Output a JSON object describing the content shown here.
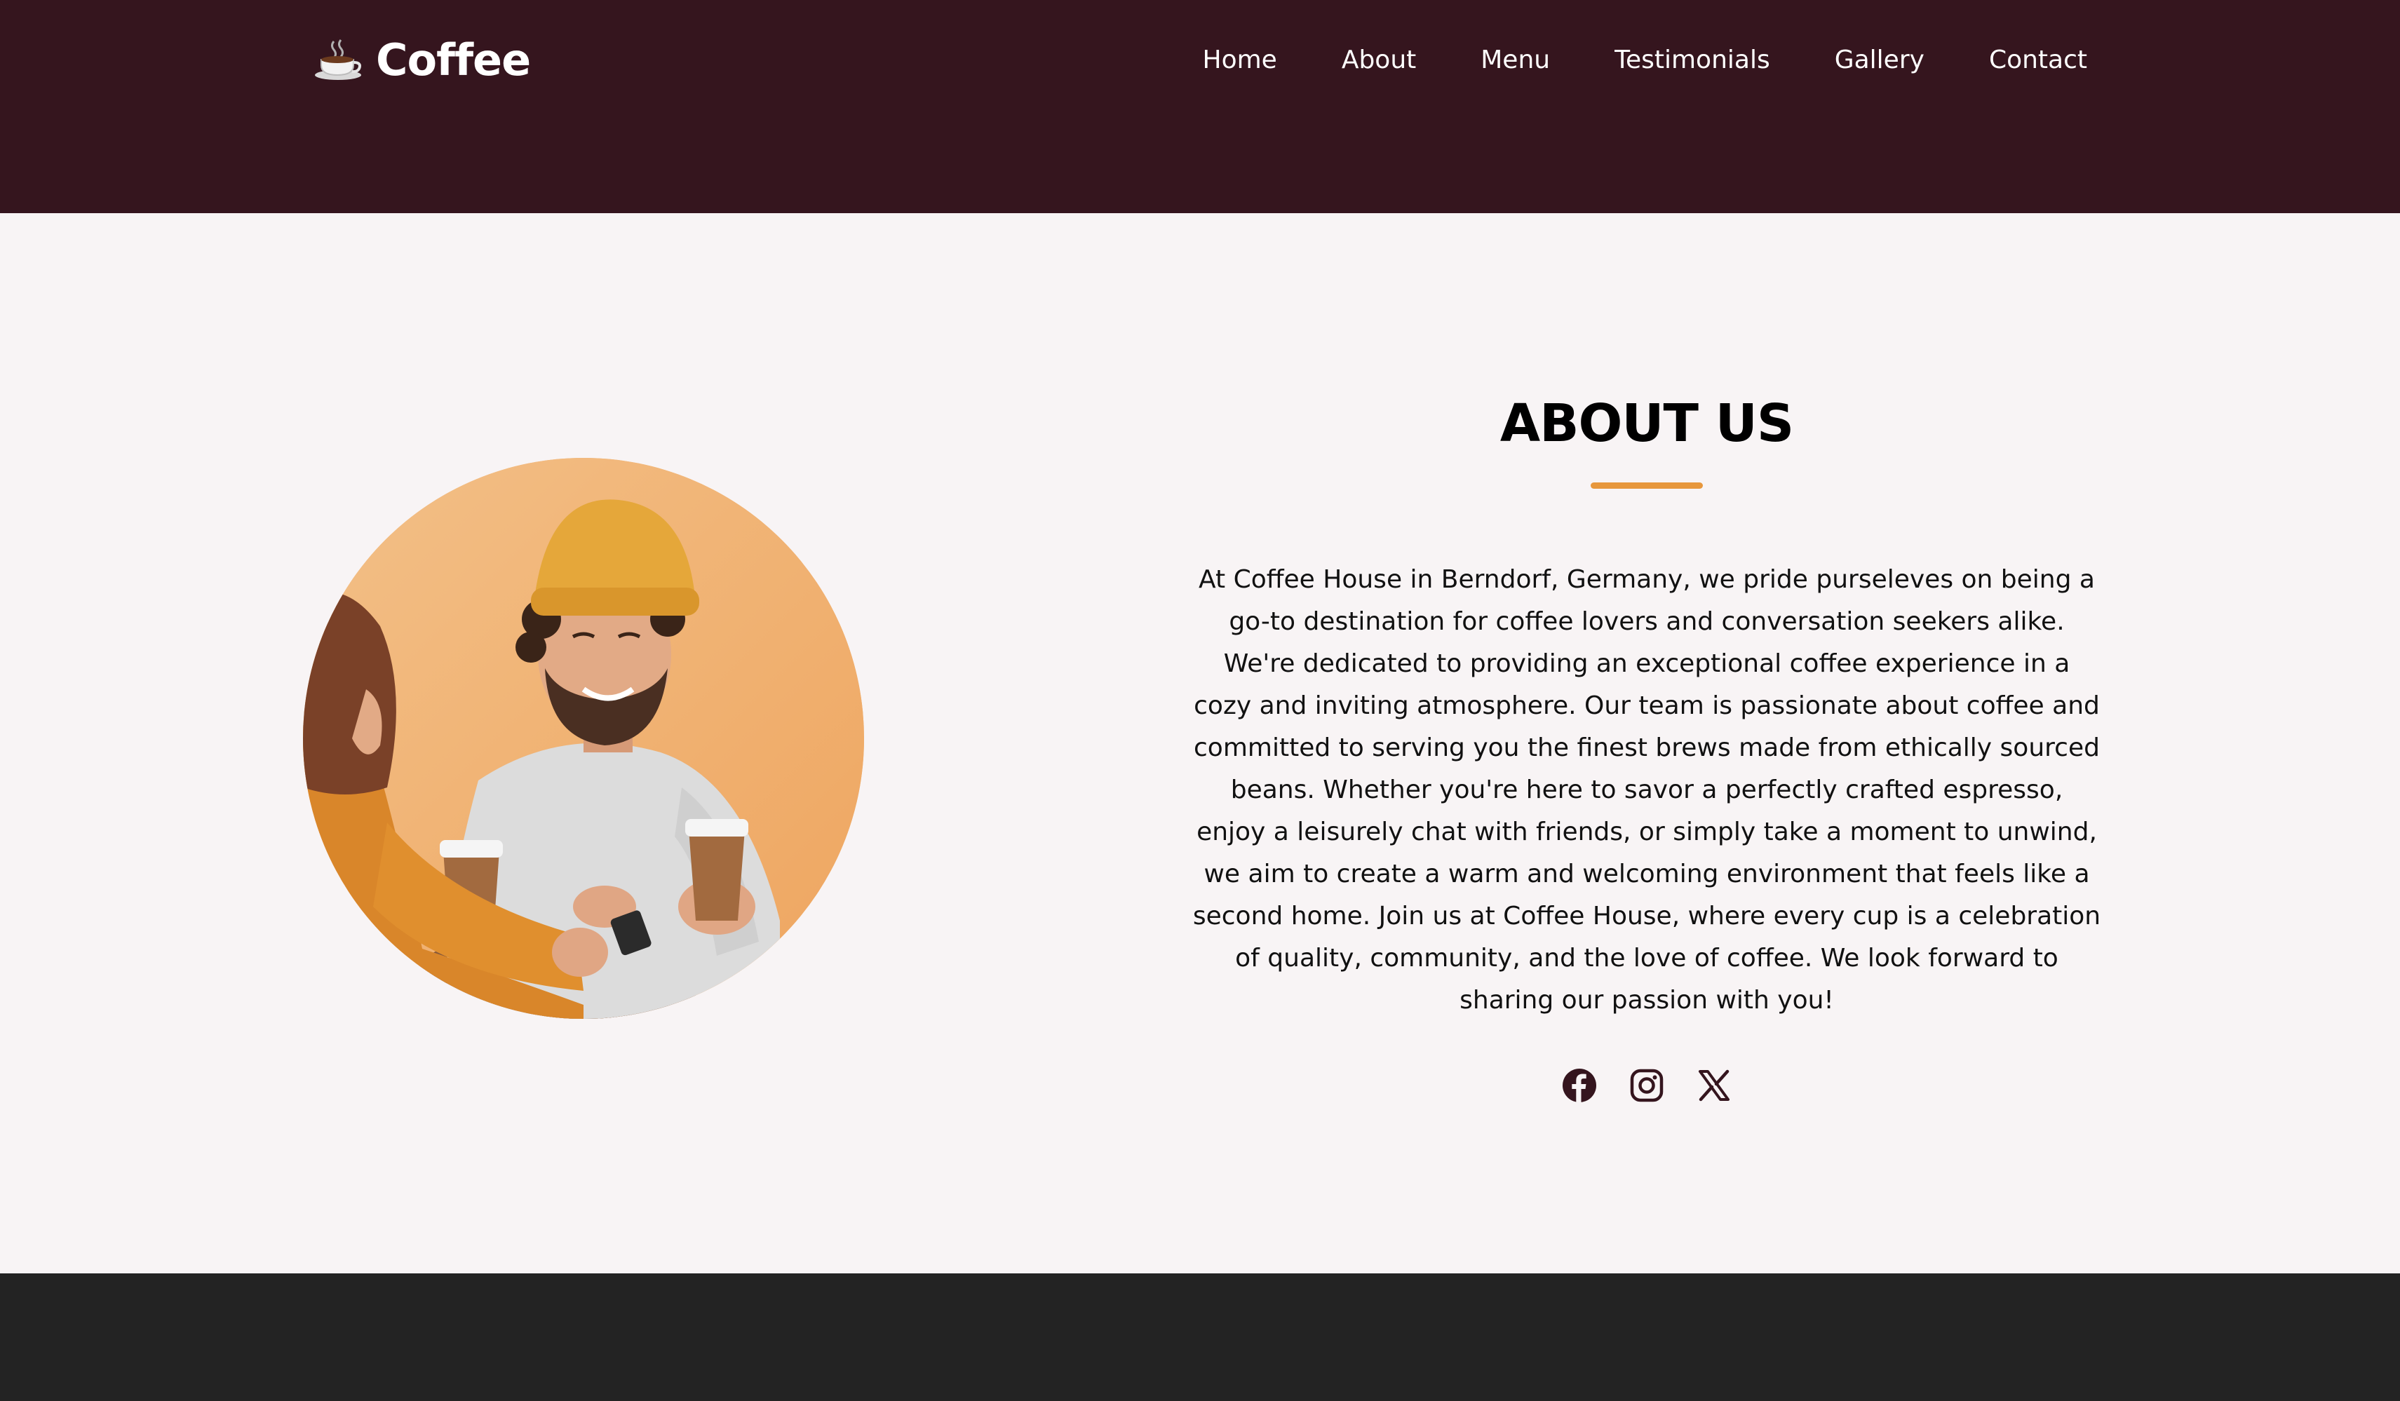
{
  "header": {
    "logo_text": "Coffee",
    "logo_icon": "coffee-cup-icon",
    "nav": [
      {
        "label": "Home"
      },
      {
        "label": "About"
      },
      {
        "label": "Menu"
      },
      {
        "label": "Testimonials"
      },
      {
        "label": "Gallery"
      },
      {
        "label": "Contact"
      }
    ]
  },
  "about": {
    "title": "ABOUT US",
    "paragraph": "At Coffee House in Berndorf, Germany, we pride purseleves on being a go-to destination for coffee lovers and conversation seekers alike. We're dedicated to providing an exceptional coffee experience in a cozy and inviting atmosphere. Our team is passionate about coffee and committed to serving you the finest brews made from ethically sourced beans. Whether you're here to savor a perfectly crafted espresso, enjoy a leisurely chat with friends, or simply take a moment to unwind, we aim to create a warm and welcoming environment that feels like a second home. Join us at Coffee House, where every cup is a celebration of quality, community, and the love of coffee. We look forward to sharing our passion with you!",
    "image": "friends-drinking-coffee-photo",
    "socials": [
      {
        "icon": "facebook-icon"
      },
      {
        "icon": "instagram-icon"
      },
      {
        "icon": "x-twitter-icon"
      }
    ]
  },
  "colors": {
    "header_bg": "#35151e",
    "page_bg": "#f8f4f5",
    "accent": "#e7973c",
    "footer_bg": "#232323"
  }
}
